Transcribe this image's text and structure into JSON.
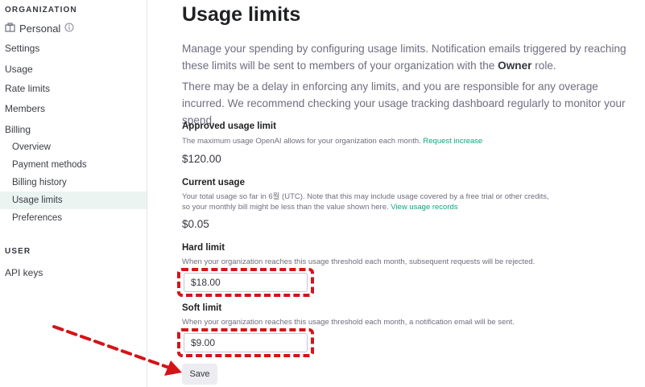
{
  "sidebar": {
    "organization_heading": "ORGANIZATION",
    "org_name": "Personal",
    "org_icon": "building-icon",
    "info_icon": "info-icon",
    "items": [
      {
        "label": "Settings"
      },
      {
        "label": "Usage"
      },
      {
        "label": "Rate limits"
      },
      {
        "label": "Members"
      },
      {
        "label": "Billing"
      }
    ],
    "billing_items": [
      {
        "label": "Overview"
      },
      {
        "label": "Payment methods"
      },
      {
        "label": "Billing history"
      },
      {
        "label": "Usage limits",
        "active": true
      },
      {
        "label": "Preferences"
      }
    ],
    "user_heading": "USER",
    "user_items": [
      {
        "label": "API keys"
      }
    ]
  },
  "main": {
    "title": "Usage limits",
    "intro_part1": "Manage your spending by configuring usage limits. Notification emails triggered by reaching these limits will be sent to members of your organization with the ",
    "intro_bold": "Owner",
    "intro_part2": " role.",
    "delay_text": "There may be a delay in enforcing any limits, and you are responsible for any overage incurred. We recommend checking your usage tracking dashboard regularly to monitor your spend.",
    "approved": {
      "label": "Approved usage limit",
      "desc": "The maximum usage OpenAI allows for your organization each month.",
      "link": "Request increase",
      "value": "$120.00"
    },
    "current": {
      "label": "Current usage",
      "desc_line1": "Your total usage so far in 6월 (UTC). Note that this may include usage covered by a free trial or other credits,",
      "desc_line2": "so your monthly bill might be less than the value shown here.",
      "link": "View usage records",
      "value": "$0.05"
    },
    "hard": {
      "label": "Hard limit",
      "desc": "When your organization reaches this usage threshold each month, subsequent requests will be rejected.",
      "value": "$18.00"
    },
    "soft": {
      "label": "Soft limit",
      "desc": "When your organization reaches this usage threshold each month, a notification email will be sent.",
      "value": "$9.00"
    },
    "save_label": "Save"
  },
  "colors": {
    "accent": "#10a37f",
    "annotation": "#d31418",
    "active_bg": "#ecf4f1"
  }
}
